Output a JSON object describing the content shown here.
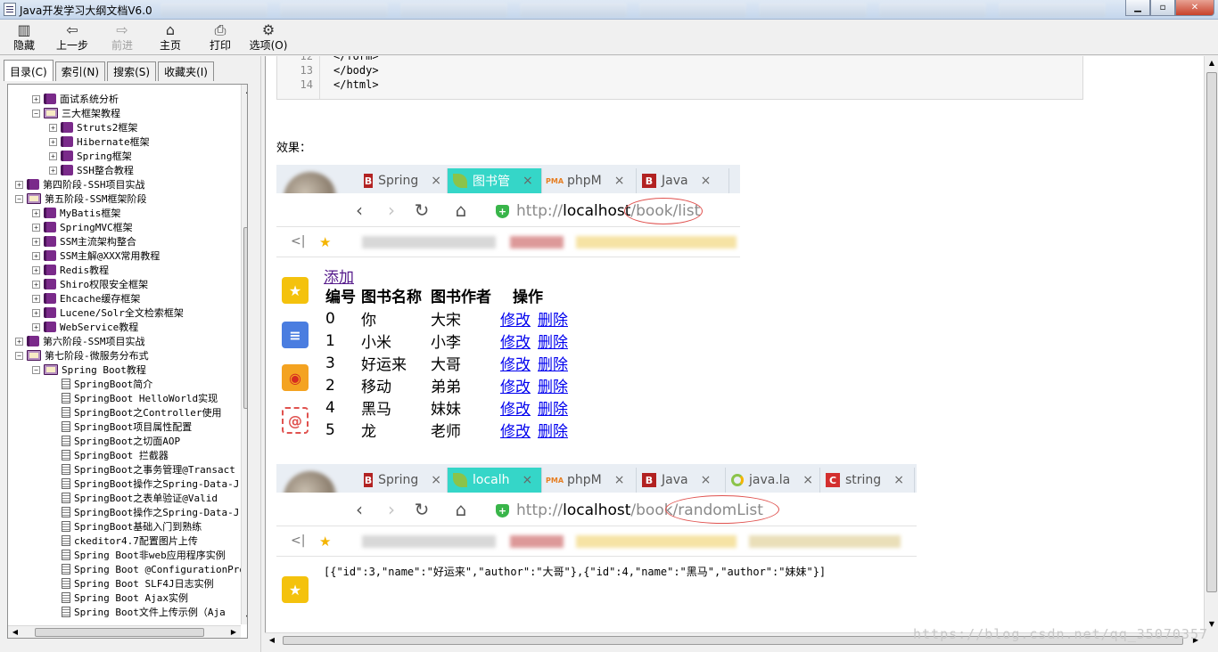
{
  "window": {
    "title": "Java开发学习大纲文档V6.0"
  },
  "toolbar": [
    {
      "id": "hide",
      "label": "隐藏",
      "icon": "hide-icon",
      "glyph": "▥",
      "disabled": false
    },
    {
      "id": "back",
      "label": "上一步",
      "icon": "back-arrow-icon",
      "glyph": "⇦",
      "disabled": false
    },
    {
      "id": "forward",
      "label": "前进",
      "icon": "forward-arrow-icon",
      "glyph": "⇨",
      "disabled": true
    },
    {
      "id": "home",
      "label": "主页",
      "icon": "home-icon",
      "glyph": "⌂",
      "disabled": false
    },
    {
      "id": "print",
      "label": "打印",
      "icon": "print-icon",
      "glyph": "⎙",
      "disabled": false
    },
    {
      "id": "options",
      "label": "选项(O)",
      "icon": "options-icon",
      "glyph": "⚙",
      "disabled": false
    }
  ],
  "left_tabs": [
    {
      "label": "目录(C)",
      "active": true
    },
    {
      "label": "索引(N)",
      "active": false
    },
    {
      "label": "搜索(S)",
      "active": false
    },
    {
      "label": "收藏夹(I)",
      "active": false
    }
  ],
  "tree": [
    {
      "level": 1,
      "type": "closed",
      "label": "面试系统分析"
    },
    {
      "level": 1,
      "type": "open",
      "label": "三大框架教程"
    },
    {
      "level": 2,
      "type": "closed",
      "label": "Struts2框架"
    },
    {
      "level": 2,
      "type": "closed",
      "label": "Hibernate框架"
    },
    {
      "level": 2,
      "type": "closed",
      "label": "Spring框架"
    },
    {
      "level": 2,
      "type": "closed",
      "label": "SSH整合教程"
    },
    {
      "level": 0,
      "type": "closed",
      "label": "第四阶段-SSH项目实战"
    },
    {
      "level": 0,
      "type": "open",
      "label": "第五阶段-SSM框架阶段"
    },
    {
      "level": 1,
      "type": "closed",
      "label": "MyBatis框架"
    },
    {
      "level": 1,
      "type": "closed",
      "label": "SpringMVC框架"
    },
    {
      "level": 1,
      "type": "closed",
      "label": "SSM主流架构整合"
    },
    {
      "level": 1,
      "type": "closed",
      "label": "SSM主解@XXX常用教程"
    },
    {
      "level": 1,
      "type": "closed",
      "label": "Redis教程"
    },
    {
      "level": 1,
      "type": "closed",
      "label": "Shiro权限安全框架"
    },
    {
      "level": 1,
      "type": "closed",
      "label": "Ehcache缓存框架"
    },
    {
      "level": 1,
      "type": "closed",
      "label": "Lucene/Solr全文检索框架"
    },
    {
      "level": 1,
      "type": "closed",
      "label": "WebService教程"
    },
    {
      "level": 0,
      "type": "closed",
      "label": "第六阶段-SSM项目实战"
    },
    {
      "level": 0,
      "type": "open",
      "label": "第七阶段-微服务分布式"
    },
    {
      "level": 1,
      "type": "open",
      "label": "Spring Boot教程"
    },
    {
      "level": 2,
      "type": "page",
      "label": "SpringBoot简介"
    },
    {
      "level": 2,
      "type": "page",
      "label": "SpringBoot HelloWorld实现"
    },
    {
      "level": 2,
      "type": "page",
      "label": "SpringBoot之Controller使用"
    },
    {
      "level": 2,
      "type": "page",
      "label": "SpringBoot项目属性配置"
    },
    {
      "level": 2,
      "type": "page",
      "label": "SpringBoot之切面AOP"
    },
    {
      "level": 2,
      "type": "page",
      "label": "SpringBoot 拦截器"
    },
    {
      "level": 2,
      "type": "page",
      "label": "SpringBoot之事务管理@Transact"
    },
    {
      "level": 2,
      "type": "page",
      "label": "SpringBoot操作之Spring-Data-J"
    },
    {
      "level": 2,
      "type": "page",
      "label": "SpringBoot之表单验证@Valid"
    },
    {
      "level": 2,
      "type": "page",
      "label": "SpringBoot操作之Spring-Data-J"
    },
    {
      "level": 2,
      "type": "page",
      "label": "SpringBoot基础入门到熟练"
    },
    {
      "level": 2,
      "type": "page",
      "label": "ckeditor4.7配置图片上传"
    },
    {
      "level": 2,
      "type": "page",
      "label": "Spring Boot非web应用程序实例"
    },
    {
      "level": 2,
      "type": "page",
      "label": "Spring Boot @ConfigurationPro"
    },
    {
      "level": 2,
      "type": "page",
      "label": "Spring Boot SLF4J日志实例"
    },
    {
      "level": 2,
      "type": "page",
      "label": "Spring Boot Ajax实例"
    },
    {
      "level": 2,
      "type": "page",
      "label": "Spring Boot文件上传示例（Aja"
    }
  ],
  "code": [
    {
      "ln": "12",
      "text": "</form>"
    },
    {
      "ln": "13",
      "text": "</body>"
    },
    {
      "ln": "14",
      "text": "</html>"
    }
  ],
  "effect_label": "效果：",
  "shot1": {
    "tabs": [
      {
        "label": "Spring",
        "fav": "b",
        "fav_text": "B",
        "active": false,
        "icon": "spring-favicon-icon"
      },
      {
        "label": "图书管",
        "fav": "leaf",
        "fav_text": "",
        "active": true,
        "icon": "leaf-favicon-icon"
      },
      {
        "label": "phpM",
        "fav": "pma",
        "fav_text": "PMA",
        "active": false,
        "icon": "phpmyadmin-favicon-icon"
      },
      {
        "label": "Java",
        "fav": "b",
        "fav_text": "B",
        "active": false,
        "icon": "java-favicon-icon"
      }
    ],
    "url": {
      "proto": "http://",
      "host": "localhost",
      "path": "/book/list"
    },
    "add_link": "添加",
    "headers": [
      "编号",
      "图书名称",
      "图书作者",
      "操作"
    ],
    "rows": [
      [
        "0",
        "你",
        "大宋"
      ],
      [
        "1",
        "小米",
        "小李"
      ],
      [
        "3",
        "好运来",
        "大哥"
      ],
      [
        "2",
        "移动",
        "弟弟"
      ],
      [
        "4",
        "黑马",
        "妹妹"
      ],
      [
        "5",
        "龙",
        "老师"
      ]
    ],
    "edit_label": "修改",
    "delete_label": "删除"
  },
  "shot2": {
    "tabs": [
      {
        "label": "Spring",
        "fav": "b",
        "fav_text": "B",
        "active": false,
        "icon": "spring-favicon-icon"
      },
      {
        "label": "localh",
        "fav": "leaf",
        "fav_text": "",
        "active": true,
        "icon": "leaf-favicon-icon"
      },
      {
        "label": "phpM",
        "fav": "pma",
        "fav_text": "PMA",
        "active": false,
        "icon": "phpmyadmin-favicon-icon"
      },
      {
        "label": "Java",
        "fav": "b",
        "fav_text": "B",
        "active": false,
        "icon": "java-favicon-icon"
      },
      {
        "label": "java.la",
        "fav": "ring",
        "fav_text": "",
        "active": false,
        "icon": "ring-favicon-icon"
      },
      {
        "label": "string",
        "fav": "c",
        "fav_text": "C",
        "active": false,
        "icon": "csdn-favicon-icon"
      }
    ],
    "url": {
      "proto": "http://",
      "host": "localhost",
      "path": "/book/randomList"
    },
    "json": "[{\"id\":3,\"name\":\"好运来\",\"author\":\"大哥\"},{\"id\":4,\"name\":\"黑马\",\"author\":\"妹妹\"}]"
  },
  "watermark": "https://blog.csdn.net/qq_35070357",
  "colors": {
    "active_tab": "#35d6c8",
    "link": "#0000ee",
    "visited_link": "#551a8b",
    "annotation": "#e0524f"
  }
}
